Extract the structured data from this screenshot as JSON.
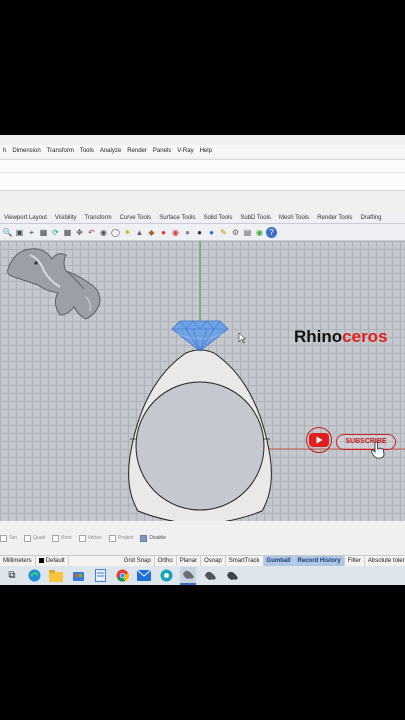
{
  "menu": [
    "h",
    "Dimension",
    "Transform",
    "Tools",
    "Analyze",
    "Render",
    "Panels",
    "V-Ray",
    "Help"
  ],
  "tabs": [
    "Viewport Layout",
    "Visibility",
    "Transform",
    "Curve Tools",
    "Surface Tools",
    "Solid Tools",
    "SubD Tools",
    "Mesh Tools",
    "Render Tools",
    "Drafting"
  ],
  "toolbar_icons": [
    "zoom-icon",
    "zoom-window-icon",
    "zoom-extents-icon",
    "zoom-selected-icon",
    "rotate-view-icon",
    "grid-icon",
    "pan-icon",
    "undo-view-icon",
    "named-views-icon",
    "viewport-icon",
    "light-icon",
    "lock-icon",
    "material-icon",
    "color-icon",
    "render-icon",
    "sphere-icon",
    "sphere-dark-icon",
    "render-preview-icon",
    "pencil-icon",
    "settings-icon",
    "layers-icon",
    "texture-icon",
    "help-icon"
  ],
  "logo": {
    "brand_black": "Rhino",
    "brand_red": "ceros"
  },
  "subscribe": {
    "label": "SUBSCRIBE"
  },
  "osnap": [
    {
      "label": "Tan",
      "checked": false
    },
    {
      "label": "Quad",
      "checked": false
    },
    {
      "label": "Knot",
      "checked": false
    },
    {
      "label": "Vertex",
      "checked": false
    },
    {
      "label": "Project",
      "checked": false
    },
    {
      "label": "Disable",
      "checked": true
    }
  ],
  "status": {
    "units": "Millimeters",
    "layer": "Default",
    "grid_snap": "Grid Snap",
    "ortho": "Ortho",
    "planar": "Planar",
    "osnap": "Osnap",
    "smarttrack": "SmartTrack",
    "gumball": "Gumball",
    "record_history": "Record History",
    "filter": "Filter",
    "tolerance": "Absolute toleran"
  },
  "taskbar_icons": [
    "task-view-icon",
    "edge-icon",
    "file-explorer-icon",
    "store-icon",
    "notepad-icon",
    "chrome-icon",
    "mail-icon",
    "windows-icon",
    "rhino-app-icon",
    "rhino-app-icon-2",
    "rhino-app-icon-3"
  ],
  "colors": {
    "gem": "#6fa3e6",
    "accent_red": "#e0201c",
    "gumball_highlight": "#aec6e8"
  }
}
